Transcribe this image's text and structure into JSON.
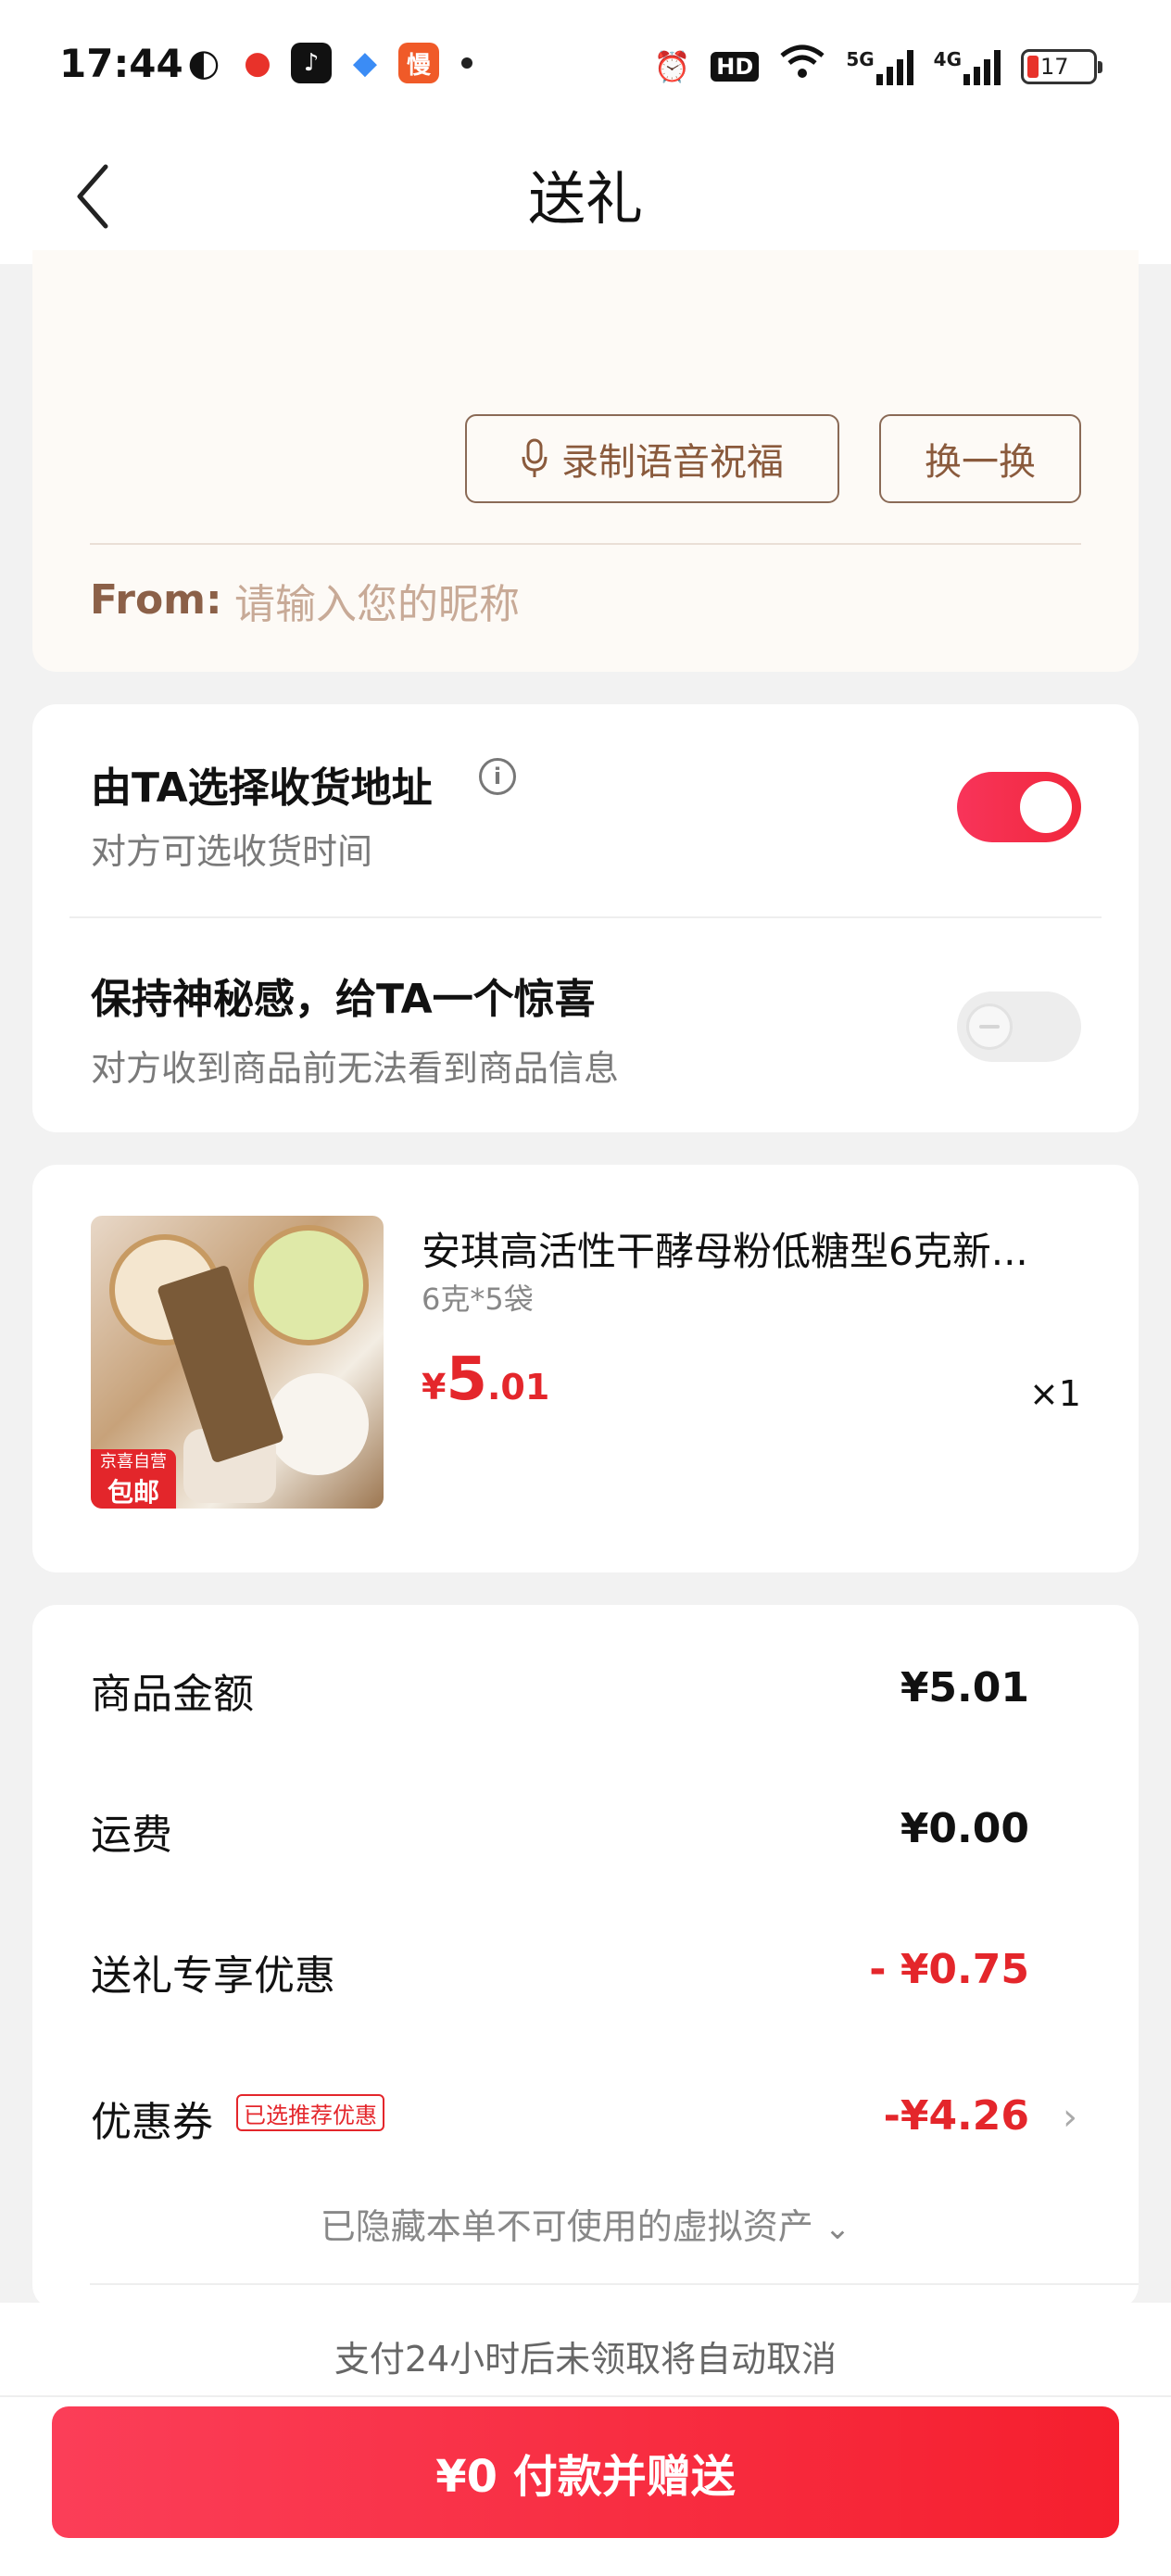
{
  "status_bar": {
    "time": "17:44",
    "apps": [
      {
        "icon": "wechat-icon",
        "glyph": "◐",
        "color": "#111111"
      },
      {
        "icon": "weibo-icon",
        "glyph": "●",
        "color": "#e8322a"
      },
      {
        "icon": "douyin-icon",
        "glyph": "♪",
        "color": "#111111"
      },
      {
        "icon": "browser-icon",
        "glyph": "◆",
        "color": "#3b8cf5"
      },
      {
        "icon": "man-app-icon",
        "glyph": "慢",
        "color": "#f05a28"
      }
    ],
    "hd_label": "HD",
    "net_5g": "5G",
    "net_4g": "4G",
    "battery": "17"
  },
  "header": {
    "title": "送礼"
  },
  "greeting": {
    "voice_button": "录制语音祝福",
    "swap_button": "换一换",
    "from_label": "From:",
    "from_placeholder": "请输入您的昵称"
  },
  "options": [
    {
      "title": "由TA选择收货地址",
      "subtitle": "对方可选收货时间",
      "enabled": true
    },
    {
      "title": "保持神秘感，给TA一个惊喜",
      "subtitle": "对方收到商品前无法看到商品信息",
      "enabled": false
    }
  ],
  "product": {
    "name": "安琪高活性干酵母粉低糖型6克新...",
    "spec": "6克*5袋",
    "price_currency": "¥",
    "price_int": "5",
    "price_dec": ".01",
    "quantity": "×1",
    "badge_top": "京喜自营",
    "badge_bottom": "包邮"
  },
  "summary": {
    "rows": [
      {
        "label": "商品金额",
        "value": "¥5.01"
      },
      {
        "label": "运费",
        "value": "¥0.00"
      },
      {
        "label": "送礼专享优惠",
        "value": "- ¥0.75"
      },
      {
        "label": "优惠券",
        "value": "-¥4.26"
      }
    ],
    "coupon_tag": "已选推荐优惠",
    "hidden_assets": "已隐藏本单不可使用的虚拟资产"
  },
  "bottom": {
    "note": "支付24小时后未领取将自动取消",
    "pay_button": "¥0 付款并赠送"
  },
  "colors": {
    "accent_red": "#e4262b",
    "toggle_on": "#f1283c",
    "brown_text": "#8b6048"
  }
}
